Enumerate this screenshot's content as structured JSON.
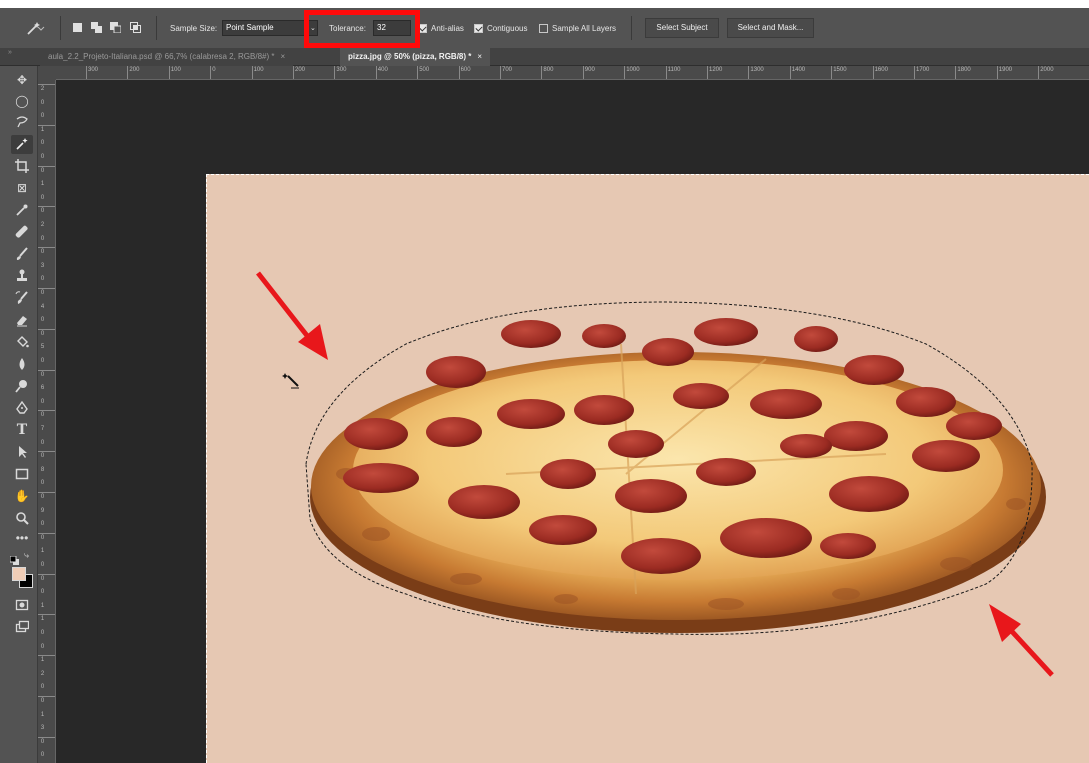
{
  "options_bar": {
    "sample_size_label": "Sample Size:",
    "sample_size_value": "Point Sample",
    "tolerance_label": "Tolerance:",
    "tolerance_value": "32",
    "anti_alias_label": "Anti-alias",
    "contiguous_label": "Contiguous",
    "sample_all_layers_label": "Sample All Layers",
    "select_subject_label": "Select Subject",
    "select_and_mask_label": "Select and Mask...",
    "anti_alias_checked": true,
    "contiguous_checked": true,
    "sample_all_layers_checked": false
  },
  "tabs": [
    {
      "label": "aula_2.2_Projeto-Italiana.psd @ 66,7% (calabresa 2, RGB/8#) *",
      "close": "×",
      "active": false
    },
    {
      "label": "pizza.jpg @ 50% (pizza, RGB/8) *",
      "close": "×",
      "active": true
    }
  ],
  "ruler_top_labels": [
    "300",
    "200",
    "100",
    "0",
    "100",
    "200",
    "300",
    "400",
    "500",
    "600",
    "700",
    "800",
    "900",
    "1000",
    "1100",
    "1200",
    "1300",
    "1400",
    "1500",
    "1600",
    "1700",
    "1800",
    "1900",
    "2000"
  ],
  "ruler_left_labels": [
    "2",
    "0",
    "0",
    "1",
    "0",
    "0",
    "0",
    "1",
    "0",
    "0",
    "2",
    "0",
    "0",
    "3",
    "0",
    "0",
    "4",
    "0",
    "0",
    "5",
    "0",
    "0",
    "6",
    "0",
    "0",
    "7",
    "0",
    "0",
    "8",
    "0",
    "0",
    "9",
    "0",
    "0",
    "1",
    "0",
    "0",
    "0",
    "1",
    "1",
    "0",
    "0",
    "1",
    "2",
    "0",
    "0",
    "1",
    "3",
    "0",
    "0"
  ],
  "colors": {
    "highlight": "#ff0a0a",
    "canvas_background": "#e6c8b3",
    "foreground_color": "#f0cdb6",
    "background_color": "#000000",
    "arrow": "#e8171b"
  },
  "tools": [
    "move-icon",
    "marquee-icon",
    "lasso-icon",
    "magic-wand-icon",
    "crop-icon",
    "frame-icon",
    "eyedropper-icon",
    "healing-brush-icon",
    "brush-icon",
    "clone-stamp-icon",
    "history-brush-icon",
    "eraser-icon",
    "paint-bucket-icon",
    "blur-icon",
    "dodge-icon",
    "pen-icon",
    "type-icon",
    "path-selection-icon",
    "rectangle-icon",
    "hand-icon",
    "zoom-icon",
    "more-tools-icon"
  ]
}
